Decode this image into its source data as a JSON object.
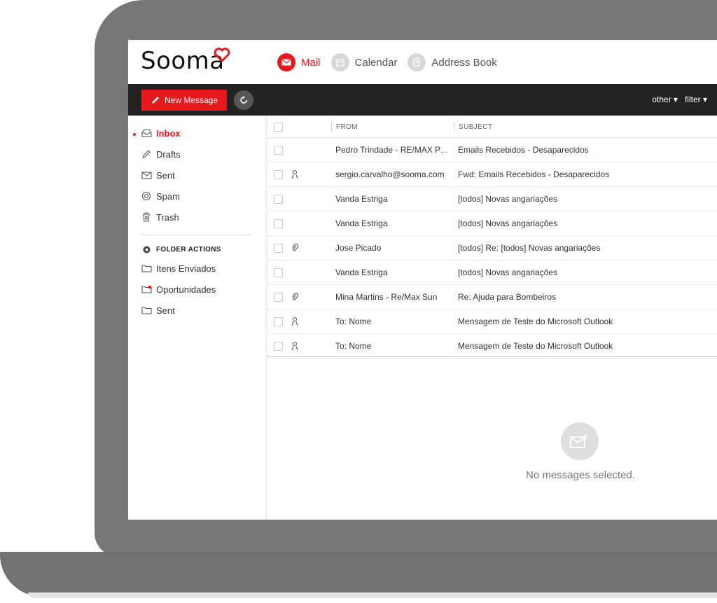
{
  "app": {
    "logo": "Sooma"
  },
  "apps": [
    {
      "label": "Mail",
      "icon": "mail-icon",
      "active": true
    },
    {
      "label": "Calendar",
      "icon": "calendar-icon",
      "active": false
    },
    {
      "label": "Address Book",
      "icon": "address-book-icon",
      "active": false
    }
  ],
  "toolbar": {
    "new_message": "New Message",
    "other": "other ▾",
    "filter": "filter ▾"
  },
  "sidebar": {
    "folders": [
      {
        "label": "Inbox",
        "icon": "inbox-icon",
        "active": true
      },
      {
        "label": "Drafts",
        "icon": "pencil-icon",
        "active": false
      },
      {
        "label": "Sent",
        "icon": "sent-icon",
        "active": false
      },
      {
        "label": "Spam",
        "icon": "spam-icon",
        "active": false
      },
      {
        "label": "Trash",
        "icon": "trash-icon",
        "active": false
      }
    ],
    "folder_actions": "FOLDER ACTIONS",
    "custom_folders": [
      {
        "label": "Itens Enviados",
        "icon": "folder-icon"
      },
      {
        "label": "Oportunidades",
        "icon": "folder-flag-icon"
      },
      {
        "label": "Sent",
        "icon": "folder-icon"
      }
    ]
  },
  "list": {
    "columns": {
      "from": "FROM",
      "subject": "SUBJECT"
    },
    "rows": [
      {
        "from": "Pedro Trindade - RE/MAX P…",
        "subject": "Emails Recebidos - Desaparecidos",
        "icon": ""
      },
      {
        "from": "sergio.carvalho@sooma.com",
        "subject": "Fwd: Emails Recebidos - Desaparecidos",
        "icon": "person-icon"
      },
      {
        "from": "Vanda Estriga",
        "subject": "[todos] Novas angariações",
        "icon": ""
      },
      {
        "from": "Vanda Estriga",
        "subject": "[todos] Novas angariações",
        "icon": ""
      },
      {
        "from": "Jose Picado",
        "subject": "[todos] Re: [todos] Novas angariações",
        "icon": "attachment-icon"
      },
      {
        "from": "Vanda Estriga",
        "subject": "[todos] Novas angariações",
        "icon": ""
      },
      {
        "from": "Mina Martins - Re/Max Sun",
        "subject": "Re: Ajuda para Bombeiros",
        "icon": "attachment-icon"
      },
      {
        "from": "To: Nome",
        "subject": "Mensagem de Teste do Microsoft Outlook",
        "icon": "person-icon"
      },
      {
        "from": "To: Nome",
        "subject": "Mensagem de Teste do Microsoft Outlook",
        "icon": "person-icon"
      }
    ]
  },
  "preview": {
    "empty_text": "No messages selected."
  },
  "colors": {
    "accent": "#e8181f",
    "toolbar_bg": "#232323",
    "laptop": "#777777"
  }
}
